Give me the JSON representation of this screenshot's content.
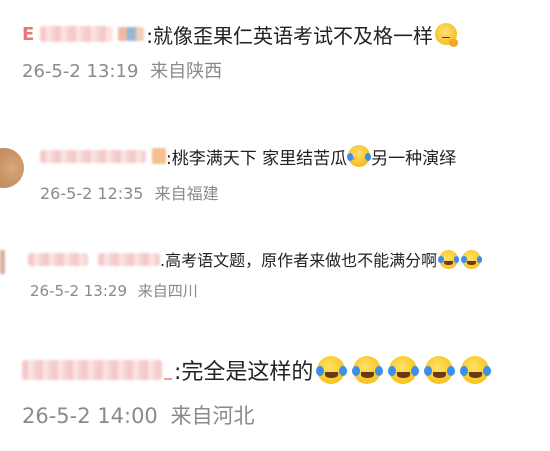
{
  "comments": [
    {
      "text": ":就像歪果仁英语考试不及格一样",
      "time": "26-5-2 13:19",
      "location": "来自陕西",
      "emojis": [
        "thinking-emoji"
      ]
    },
    {
      "text": ":桃李满天下 家里结苦瓜",
      "text_after": "另一种演绎",
      "time": "26-5-2 12:35",
      "location": "来自福建",
      "emojis": [
        "crying-emoji"
      ]
    },
    {
      "text": ".高考语文题，原作者来做也不能满分啊",
      "time": "26-5-2 13:29",
      "location": "来自四川",
      "emojis": [
        "laugh-cry-emoji",
        "laugh-cry-emoji"
      ]
    },
    {
      "text": ":完全是这样的",
      "time": "26-5-2 14:00",
      "location": "来自河北",
      "emojis": [
        "laugh-cry-emoji",
        "laugh-cry-emoji",
        "laugh-cry-emoji",
        "laugh-cry-emoji",
        "laugh-cry-emoji"
      ]
    }
  ]
}
